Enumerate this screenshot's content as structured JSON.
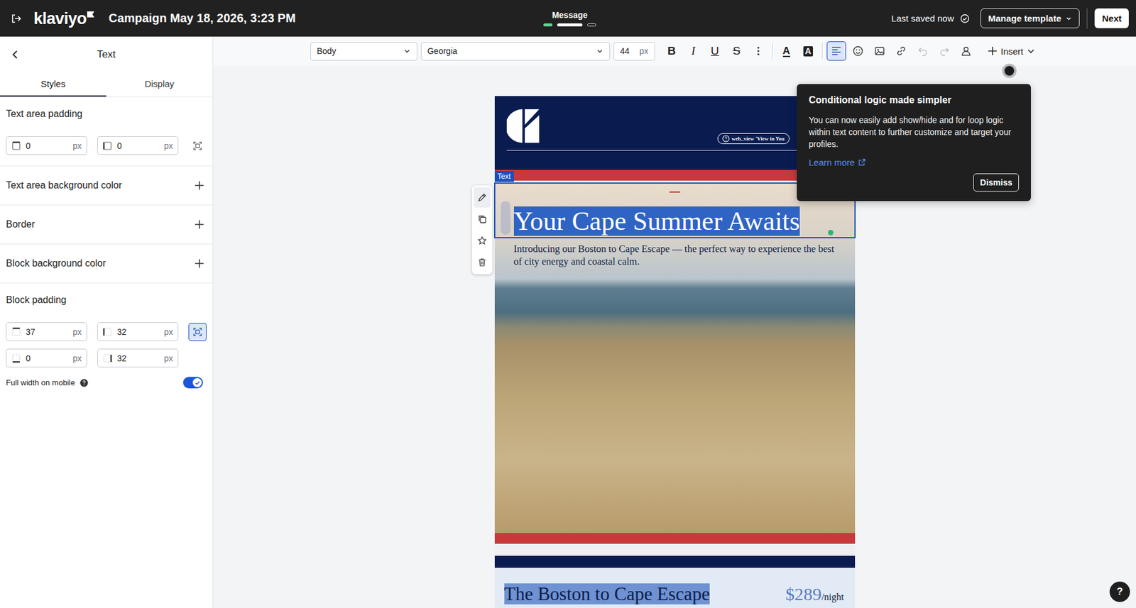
{
  "topbar": {
    "logo": "klaviyo",
    "title": "Campaign May 18, 2026, 3:23 PM",
    "step_label": "Message",
    "steps": [
      {
        "status": "done"
      },
      {
        "status": "current"
      },
      {
        "status": "todo"
      }
    ],
    "saved": "Last saved now",
    "manage": "Manage template",
    "next": "Next"
  },
  "panel": {
    "title": "Text",
    "tabs": [
      {
        "label": "Styles",
        "selected": true
      },
      {
        "label": "Display",
        "selected": false
      }
    ],
    "text_area_padding": {
      "label": "Text area padding",
      "linked": false,
      "fields": [
        {
          "kind": "vertical",
          "value": "0",
          "unit": "px"
        },
        {
          "kind": "horizontal",
          "value": "0",
          "unit": "px"
        }
      ]
    },
    "add_rows": [
      "Text area background color",
      "Border",
      "Block background color"
    ],
    "block_padding": {
      "label": "Block padding",
      "linked": true,
      "fields": [
        {
          "kind": "top",
          "value": "37",
          "unit": "px"
        },
        {
          "kind": "left",
          "value": "32",
          "unit": "px"
        },
        {
          "kind": "bottom",
          "value": "0",
          "unit": "px"
        },
        {
          "kind": "right",
          "value": "32",
          "unit": "px"
        }
      ]
    },
    "full_width": {
      "label": "Full width on mobile",
      "on": true
    }
  },
  "toolbar": {
    "style": "Body",
    "font": "Georgia",
    "size": "44",
    "unit": "px",
    "format": [
      {
        "label": "B",
        "kind": "bold",
        "active": false
      },
      {
        "label": "I",
        "kind": "italic",
        "active": false
      },
      {
        "label": "U",
        "kind": "underline",
        "active": false
      },
      {
        "label": "S",
        "kind": "strike",
        "active": false
      }
    ],
    "tools": [
      {
        "kind": "more",
        "label": "",
        "active": false,
        "disabled": false
      },
      {
        "kind": "text-color",
        "label": "A",
        "active": false,
        "disabled": false
      },
      {
        "kind": "highlight",
        "label": "A",
        "active": false,
        "disabled": false
      },
      {
        "kind": "align-left",
        "label": "",
        "active": true,
        "disabled": false
      },
      {
        "kind": "emoji",
        "label": "",
        "active": false,
        "disabled": false
      },
      {
        "kind": "image",
        "label": "",
        "active": false,
        "disabled": false
      },
      {
        "kind": "link",
        "label": "",
        "active": false,
        "disabled": false
      },
      {
        "kind": "undo",
        "label": "",
        "active": false,
        "disabled": true
      },
      {
        "kind": "redo",
        "label": "",
        "active": false,
        "disabled": true
      },
      {
        "kind": "personalize",
        "label": "",
        "active": false,
        "disabled": false
      }
    ],
    "insert": "Insert"
  },
  "email": {
    "view_link": "web_view 'View in You",
    "block_label": "Text",
    "heading": "Your Cape Summer Awaits",
    "heading_selected": true,
    "subtitle": "Introducing our Boston to Cape Escape — the perfect way to experience the best of city energy and coastal calm.",
    "offer_title": "The Boston to Cape Escape",
    "offer_title_selected": true,
    "price": "$289",
    "per": "/night"
  },
  "tooltip": {
    "title": "Conditional logic made simpler",
    "body": "You can now easily add show/hide and for loop logic within text content to further customize and target your profiles.",
    "link": "Learn more",
    "dismiss": "Dismiss"
  },
  "help": "?"
}
